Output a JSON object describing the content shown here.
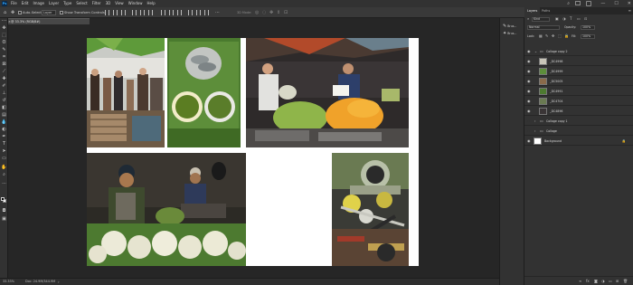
{
  "app": {
    "logo": "Ps"
  },
  "menubar": {
    "items": [
      "File",
      "Edit",
      "Image",
      "Layer",
      "Type",
      "Select",
      "Filter",
      "3D",
      "View",
      "Window",
      "Help"
    ],
    "window_controls": [
      "—",
      "☐",
      "✕"
    ]
  },
  "options_bar": {
    "auto_select_label": "Auto-Select:",
    "auto_select_value": "Layer",
    "show_transform_label": "Show Transform Controls",
    "mode_3d_label": "3D Mode:"
  },
  "document_tab": {
    "title": "@ 33.3% (RGB/8#)"
  },
  "status_bar": {
    "zoom": "33.33%",
    "doc_size": "Doc: 24.9M/344.9M",
    "arrow": "›"
  },
  "dock": {
    "items": [
      {
        "label": "Brus...",
        "icon": "brush-icon"
      },
      {
        "label": "Brus...",
        "icon": "brush-presets-icon"
      }
    ]
  },
  "layers_panel": {
    "tabs": [
      "Layers",
      "Paths"
    ],
    "kind_label": "Kind",
    "blend_mode": "Normal",
    "opacity_label": "Opacity:",
    "opacity_value": "100%",
    "lock_label": "Lock:",
    "fill_label": "Fill:",
    "fill_value": "100%",
    "layers": [
      {
        "name": "Collage copy 2",
        "type": "group",
        "visible": true
      },
      {
        "name": "_DC4998",
        "type": "pixel",
        "visible": true
      },
      {
        "name": "_DC4999",
        "type": "pixel",
        "visible": true
      },
      {
        "name": "_DC5005",
        "type": "pixel",
        "visible": true
      },
      {
        "name": "_DC4991",
        "type": "pixel",
        "visible": true
      },
      {
        "name": "_DC4704",
        "type": "pixel",
        "visible": true
      },
      {
        "name": "_DC4896",
        "type": "pixel",
        "visible": true
      },
      {
        "name": "Collage copy 1",
        "type": "group",
        "visible": false
      },
      {
        "name": "Collage",
        "type": "group",
        "visible": false
      },
      {
        "name": "Background",
        "type": "background",
        "visible": true
      }
    ],
    "footer_icons": [
      "link",
      "fx",
      "mask",
      "adjustment",
      "folder",
      "new-layer",
      "trash"
    ]
  }
}
